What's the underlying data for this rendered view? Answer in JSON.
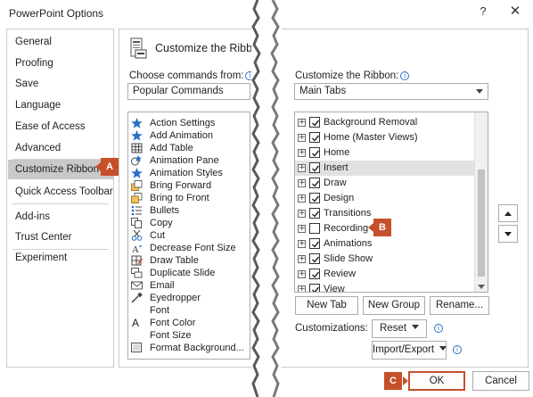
{
  "window": {
    "title": "PowerPoint Options",
    "help_glyph": "?",
    "close_glyph": "✕"
  },
  "sidebar": {
    "items": [
      {
        "label": "General"
      },
      {
        "label": "Proofing"
      },
      {
        "label": "Save"
      },
      {
        "label": "Language"
      },
      {
        "label": "Ease of Access"
      },
      {
        "label": "Advanced"
      },
      {
        "label": "Customize Ribbon",
        "selected": true
      },
      {
        "label": "Quick Access Toolbar"
      },
      {
        "label": "Add-ins"
      },
      {
        "label": "Trust Center"
      },
      {
        "label": "Experiment"
      }
    ]
  },
  "main": {
    "header_title": "Customize the Ribbon",
    "choose_label": "Choose commands from:",
    "choose_value": "Popular Commands",
    "ribbon_label": "Customize the Ribbon:",
    "ribbon_value": "Main Tabs",
    "info_glyph": "i",
    "commands": [
      {
        "label": "Action Settings",
        "icon": "star-icon"
      },
      {
        "label": "Add Animation",
        "icon": "star-icon"
      },
      {
        "label": "Add Table",
        "icon": "table-icon"
      },
      {
        "label": "Animation Pane",
        "icon": "animation-pane-icon"
      },
      {
        "label": "Animation Styles",
        "icon": "star-icon"
      },
      {
        "label": "Bring Forward",
        "icon": "bring-forward-icon"
      },
      {
        "label": "Bring to Front",
        "icon": "bring-front-icon"
      },
      {
        "label": "Bullets",
        "icon": "bullets-icon"
      },
      {
        "label": "Copy",
        "icon": "copy-icon"
      },
      {
        "label": "Cut",
        "icon": "scissors-icon"
      },
      {
        "label": "Decrease Font Size",
        "icon": "font-decrease-icon"
      },
      {
        "label": "Draw Table",
        "icon": "draw-table-icon"
      },
      {
        "label": "Duplicate Slide",
        "icon": "duplicate-slide-icon"
      },
      {
        "label": "Email",
        "icon": "email-icon"
      },
      {
        "label": "Eyedropper",
        "icon": "eyedropper-icon"
      },
      {
        "label": "Font",
        "icon": "font-icon"
      },
      {
        "label": "Font Color",
        "icon": "font-color-icon"
      },
      {
        "label": "Font Size",
        "icon": "font-size-icon"
      },
      {
        "label": "Format Background...",
        "icon": "format-background-icon"
      }
    ],
    "tabs": [
      {
        "label": "Background Removal",
        "checked": true
      },
      {
        "label": "Home (Master Views)",
        "checked": true
      },
      {
        "label": "Home",
        "checked": true
      },
      {
        "label": "Insert",
        "checked": true,
        "highlighted": true
      },
      {
        "label": "Draw",
        "checked": true
      },
      {
        "label": "Design",
        "checked": true
      },
      {
        "label": "Transitions",
        "checked": true
      },
      {
        "label": "Recording",
        "checked": false
      },
      {
        "label": "Animations",
        "checked": true
      },
      {
        "label": "Slide Show",
        "checked": true
      },
      {
        "label": "Review",
        "checked": true
      },
      {
        "label": "View",
        "checked": true
      }
    ],
    "expander_glyph": "+",
    "buttons": {
      "new_tab": "New Tab",
      "new_group": "New Group",
      "rename": "Rename..."
    },
    "customizations_label": "Customizations:",
    "reset_label": "Reset",
    "import_export_label": "Import/Export"
  },
  "callouts": {
    "a": "A",
    "b": "B",
    "c": "C"
  },
  "footer": {
    "ok_label": "OK",
    "cancel_label": "Cancel"
  },
  "colors": {
    "callout": "#c5502b",
    "selected_nav": "#c9c9c9",
    "icon_blue": "#2b6fc4"
  }
}
